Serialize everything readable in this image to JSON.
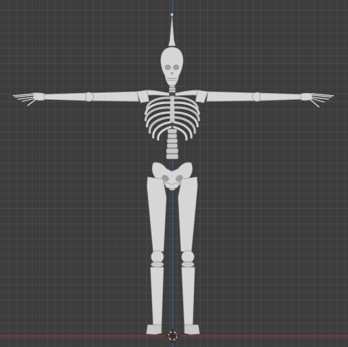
{
  "viewport": {
    "background_color": "#3d3d3d",
    "grid_color": "#4a4a4a",
    "x_axis_color": "#9b3a44",
    "z_axis_color": "#3a5ea8"
  },
  "scene": {
    "model": "skeleton",
    "pose": "T-pose",
    "bone_color": "#c9c9c9",
    "cursor_icon": "3d-cursor-icon"
  }
}
